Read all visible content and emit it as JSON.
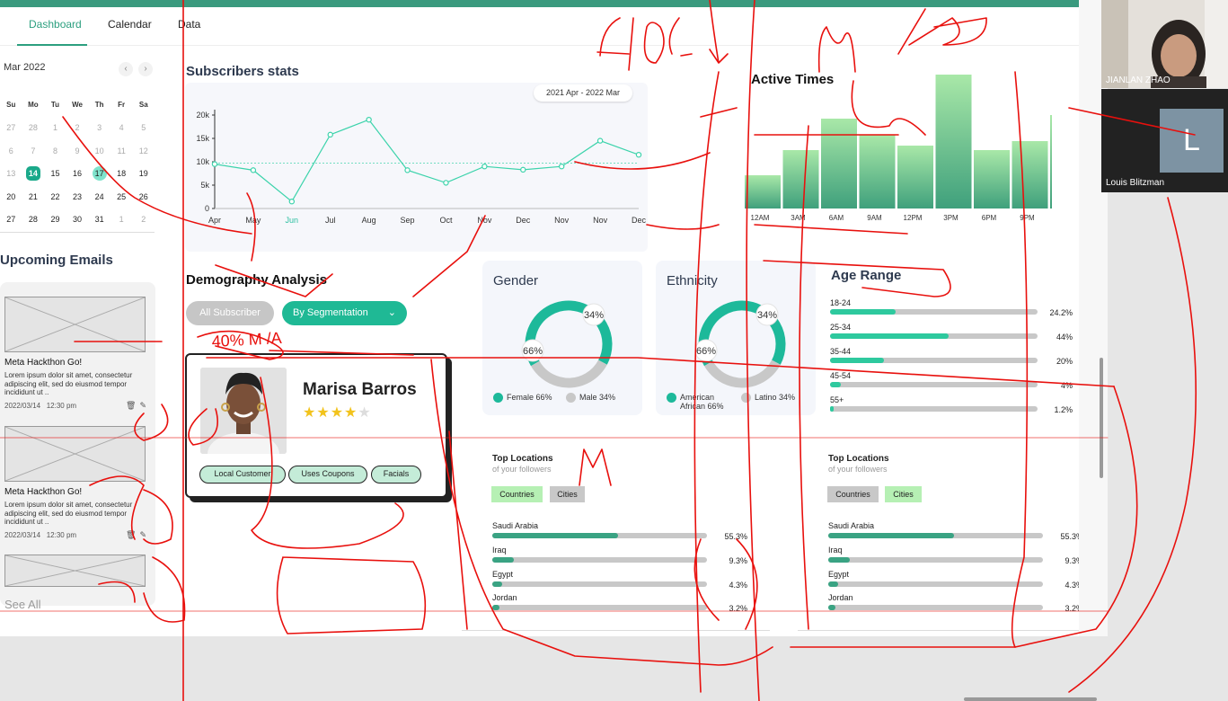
{
  "tabs": [
    "Dashboard",
    "Calendar",
    "Data"
  ],
  "calendar": {
    "month_label": "Mar 2022",
    "prev_icon": "chevron-left-icon",
    "next_icon": "chevron-right-icon",
    "weekdays": [
      "Su",
      "Mo",
      "Tu",
      "We",
      "Th",
      "Fr",
      "Sa"
    ],
    "weeks": [
      [
        "27",
        "28",
        "1",
        "2",
        "3",
        "4",
        "5"
      ],
      [
        "6",
        "7",
        "8",
        "9",
        "10",
        "11",
        "12"
      ],
      [
        "13",
        "14",
        "15",
        "16",
        "17",
        "18",
        "19"
      ],
      [
        "20",
        "21",
        "22",
        "23",
        "24",
        "25",
        "26"
      ],
      [
        "27",
        "28",
        "29",
        "30",
        "31",
        "1",
        "2"
      ]
    ],
    "muted": [
      [
        0,
        0
      ],
      [
        0,
        1
      ],
      [
        0,
        2
      ],
      [
        0,
        3
      ],
      [
        0,
        4
      ],
      [
        0,
        5
      ],
      [
        0,
        6
      ],
      [
        1,
        0
      ],
      [
        1,
        1
      ],
      [
        1,
        2
      ],
      [
        1,
        3
      ],
      [
        1,
        4
      ],
      [
        1,
        5
      ],
      [
        1,
        6
      ],
      [
        2,
        0
      ],
      [
        4,
        5
      ],
      [
        4,
        6
      ]
    ],
    "today": [
      2,
      1
    ],
    "selected": [
      2,
      4
    ]
  },
  "emails": {
    "title": "Upcoming Emails",
    "items": [
      {
        "title": "Meta Hackthon Go!",
        "body": "Lorem ipsum dolor sit amet, consectetur adipiscing elit, sed do eiusmod tempor incididunt ut ..",
        "date": "2022/03/14",
        "time": "12:30 pm"
      },
      {
        "title": "Meta Hackthon Go!",
        "body": "Lorem ipsum dolor sit amet, consectetur adipiscing elit, sed do eiusmod tempor incididunt ut ..",
        "date": "2022/03/14",
        "time": "12:30 pm"
      }
    ],
    "see_all": "See All"
  },
  "subscribers": {
    "title": "Subscribers stats",
    "date_range": "2021 Apr - 2022 Mar"
  },
  "chart_data": [
    {
      "type": "line",
      "title": "Subscribers stats",
      "x": [
        "Apr",
        "May",
        "Jun",
        "Jul",
        "Aug",
        "Sep",
        "Oct",
        "Nov",
        "Dec",
        "Nov",
        "Nov",
        "Dec"
      ],
      "values": [
        9500,
        8200,
        1500,
        15800,
        19000,
        8200,
        5500,
        9000,
        8300,
        9000,
        14500,
        11500
      ],
      "yticks": [
        "0",
        "5k",
        "10k",
        "15k",
        "20k"
      ],
      "ylim": [
        0,
        20000
      ],
      "reference_line": 9700,
      "highlight_tick": "Jun",
      "color": "#3cd3ab",
      "highlight_color": "#2cbfa0"
    },
    {
      "type": "bar",
      "title": "Active Times",
      "categories": [
        "12AM",
        "3AM",
        "6AM",
        "9AM",
        "12PM",
        "3PM",
        "6PM",
        "9PM"
      ],
      "values": [
        37,
        65,
        100,
        82,
        70,
        149,
        65,
        75,
        104
      ],
      "bar_count": 9,
      "color_top": "#a9e8a8",
      "color_bottom": "#3fa07c"
    }
  ],
  "demography": {
    "title": "Demography Analysis",
    "all_subscriber": "All Subscriber",
    "by_segmentation": "By Segmentation",
    "dropdown_icon": "chevron-down-icon",
    "profile": {
      "name": "Marisa Barros",
      "rating": 4,
      "max_rating": 5,
      "tags": [
        "Local Customer",
        "Uses Coupons",
        "Facials"
      ]
    }
  },
  "gender": {
    "title": "Gender",
    "segments": [
      {
        "label": "66%",
        "value": 66,
        "color": "#1db99a"
      },
      {
        "label": "34%",
        "value": 34,
        "color": "#c8c8c8"
      }
    ],
    "legend": [
      {
        "text": "Female 66%",
        "color": "#1db99a"
      },
      {
        "text": "Male 34%",
        "color": "#c8c8c8"
      }
    ]
  },
  "ethnicity": {
    "title": "Ethnicity",
    "segments": [
      {
        "label": "66%",
        "value": 66,
        "color": "#1db99a"
      },
      {
        "label": "34%",
        "value": 34,
        "color": "#c8c8c8"
      }
    ],
    "legend": [
      {
        "text": "American African 66%",
        "color": "#1db99a"
      },
      {
        "text": "Latino 34%",
        "color": "#c8c8c8"
      }
    ]
  },
  "age_range": {
    "title": "Age Range",
    "items": [
      {
        "label": "18-24",
        "pct": "24.2%",
        "value": 24.2
      },
      {
        "label": "25-34",
        "pct": "44%",
        "value": 44
      },
      {
        "label": "35-44",
        "pct": "20%",
        "value": 20
      },
      {
        "label": "45-54",
        "pct": "4%",
        "value": 4
      },
      {
        "label": "55+",
        "pct": "1.2%",
        "value": 1.2
      }
    ],
    "fill_color": "#2ec99e"
  },
  "top_locations": [
    {
      "title": "Top Locations",
      "subtitle": "of your followers",
      "tabs": [
        "Countries",
        "Cities"
      ],
      "active_tab": 0,
      "items": [
        {
          "name": "Saudi Arabia",
          "pct": "55.3%",
          "value": 55.3
        },
        {
          "name": "Iraq",
          "pct": "9.3%",
          "value": 9.3
        },
        {
          "name": "Egypt",
          "pct": "4.3%",
          "value": 4.3
        },
        {
          "name": "Jordan",
          "pct": "3.2%",
          "value": 3.2
        }
      ]
    },
    {
      "title": "Top Locations",
      "subtitle": "of your followers",
      "tabs": [
        "Countries",
        "Cities"
      ],
      "active_tab": 1,
      "items": [
        {
          "name": "Saudi Arabia",
          "pct": "55.3%",
          "value": 55.3
        },
        {
          "name": "Iraq",
          "pct": "9.3%",
          "value": 9.3
        },
        {
          "name": "Egypt",
          "pct": "4.3%",
          "value": 4.3
        },
        {
          "name": "Jordan",
          "pct": "3.2%",
          "value": 3.2
        }
      ]
    }
  ],
  "participants": [
    {
      "name": "JIANLAN ZHAO"
    },
    {
      "name": "Louis Blitzman",
      "initial": "L"
    }
  ],
  "annotation": {
    "color": "#e8100d",
    "text": "40% M /A"
  },
  "colors": {
    "brand": "#3a9a7e",
    "accent": "#2c9f7f",
    "chip_active": "#b6f0b4",
    "chip_inactive": "#c8c8c8",
    "loc_fill": "#3aa383"
  }
}
